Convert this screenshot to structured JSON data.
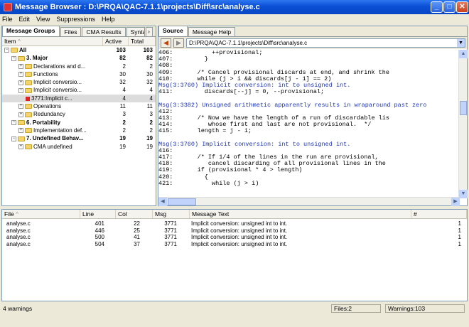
{
  "window": {
    "title": "Message Browser : D:\\PRQA\\QAC-7.1.1\\projects\\Diff\\src\\analyse.c"
  },
  "menu": [
    "File",
    "Edit",
    "View",
    "Suppressions",
    "Help"
  ],
  "left_tabs": [
    "Message Groups",
    "Files",
    "CMA Results",
    "Synta"
  ],
  "tree_headers": {
    "item": "Item",
    "active": "Active",
    "total": "Total"
  },
  "tree": [
    {
      "label": "All",
      "active": "103",
      "total": "103",
      "indent": 0,
      "bold": true
    },
    {
      "label": "3. Major",
      "active": "82",
      "total": "82",
      "indent": 1,
      "bold": true
    },
    {
      "label": "Declarations and d...",
      "active": "2",
      "total": "2",
      "indent": 2
    },
    {
      "label": "Functions",
      "active": "30",
      "total": "30",
      "indent": 2
    },
    {
      "label": "Implicit conversio...",
      "active": "32",
      "total": "32",
      "indent": 2
    },
    {
      "label": "Implicit conversio...",
      "active": "4",
      "total": "4",
      "indent": 2
    },
    {
      "label": "3771:Implicit c...",
      "active": "4",
      "total": "4",
      "indent": 3,
      "leaf": true
    },
    {
      "label": "Operations",
      "active": "11",
      "total": "11",
      "indent": 2
    },
    {
      "label": "Redundancy",
      "active": "3",
      "total": "3",
      "indent": 2
    },
    {
      "label": "6. Portability",
      "active": "2",
      "total": "2",
      "indent": 1,
      "bold": true
    },
    {
      "label": "Implementation def...",
      "active": "2",
      "total": "2",
      "indent": 2
    },
    {
      "label": "7. Undefined Behav...",
      "active": "19",
      "total": "19",
      "indent": 1,
      "bold": true
    },
    {
      "label": "CMA undefined",
      "active": "19",
      "total": "19",
      "indent": 2
    }
  ],
  "right_tabs": [
    "Source",
    "Message Help"
  ],
  "path": "D:\\PRQA\\QAC-7.1.1\\projects\\Diff\\src\\analyse.c",
  "code_lines": [
    {
      "n": "406:",
      "t": "          ++provisional;"
    },
    {
      "n": "407:",
      "t": "        }"
    },
    {
      "n": "408:",
      "t": ""
    },
    {
      "n": "409:",
      "t": "      /* Cancel provisional discards at end, and shrink the"
    },
    {
      "n": "410:",
      "t": "      while (j > i && discards[j - 1] == 2)"
    },
    {
      "n": "",
      "t": "",
      "msg": "Msg(3:3760) Implicit conversion: int to unsigned int."
    },
    {
      "n": "411:",
      "t": "        discards[--j] = 0, --provisional;"
    },
    {
      "n": "",
      "t": ""
    },
    {
      "n": "",
      "t": "",
      "msg": "Msg(3:3382) Unsigned arithmetic apparently results in wraparound past zero"
    },
    {
      "n": "412:",
      "t": ""
    },
    {
      "n": "413:",
      "t": "      /* Now we have the length of a run of discardable lis"
    },
    {
      "n": "414:",
      "t": "         whose first and last are not provisional.  */"
    },
    {
      "n": "415:",
      "t": "      length = j - i;"
    },
    {
      "n": "",
      "t": ""
    },
    {
      "n": "",
      "t": "",
      "msg": "Msg(3:3760) Implicit conversion: int to unsigned int."
    },
    {
      "n": "416:",
      "t": ""
    },
    {
      "n": "417:",
      "t": "      /* If 1/4 of the lines in the run are provisional,"
    },
    {
      "n": "418:",
      "t": "         cancel discarding of all provisional lines in the"
    },
    {
      "n": "419:",
      "t": "      if (provisional * 4 > length)"
    },
    {
      "n": "420:",
      "t": "        {"
    },
    {
      "n": "421:",
      "t": "          while (j > i)"
    }
  ],
  "results_headers": {
    "file": "File",
    "line": "Line",
    "col": "Col",
    "msg": "Msg",
    "text": "Message Text",
    "count": "#"
  },
  "results": [
    {
      "file": "analyse.c",
      "line": "401",
      "col": "22",
      "msg": "3771",
      "text": "Implicit conversion: unsigned int to int.",
      "count": "1"
    },
    {
      "file": "analyse.c",
      "line": "446",
      "col": "25",
      "msg": "3771",
      "text": "Implicit conversion: unsigned int to int.",
      "count": "1"
    },
    {
      "file": "analyse.c",
      "line": "500",
      "col": "41",
      "msg": "3771",
      "text": "Implicit conversion: unsigned int to int.",
      "count": "1"
    },
    {
      "file": "analyse.c",
      "line": "504",
      "col": "37",
      "msg": "3771",
      "text": "Implicit conversion: unsigned int to int.",
      "count": "1"
    }
  ],
  "status": {
    "left": "4 warnings",
    "files": "Files:2",
    "warnings": "Warnings:103"
  }
}
